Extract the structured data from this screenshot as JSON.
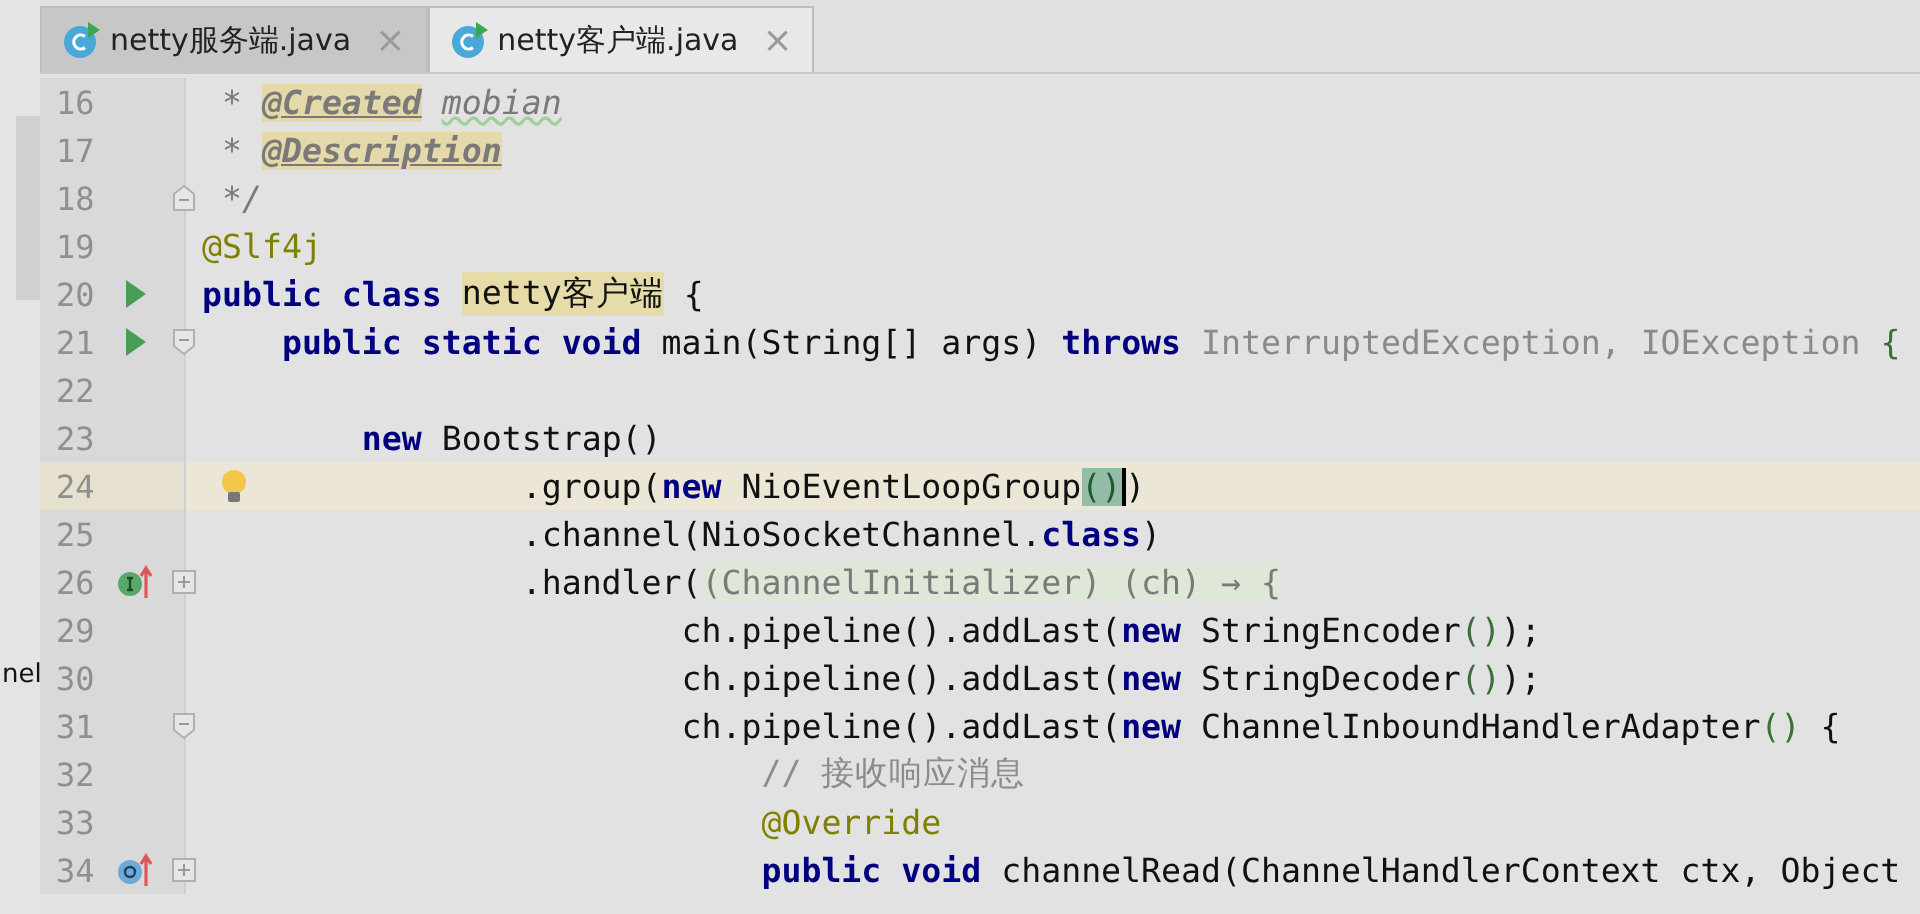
{
  "side_panel": {
    "text": "nel"
  },
  "tabs": [
    {
      "label": "netty服务端.java",
      "selected": false,
      "close": "×"
    },
    {
      "label": "netty客户端.java",
      "selected": true,
      "close": "×"
    }
  ],
  "lines": [
    {
      "number": "16",
      "current": false,
      "tokens": [
        {
          "t": " * ",
          "kind": "doc"
        },
        {
          "t": "@Created",
          "kind": "doc-tag"
        },
        {
          "t": " mobian",
          "kind": "doc-typo"
        }
      ]
    },
    {
      "number": "17",
      "current": false,
      "tokens": [
        {
          "t": " * ",
          "kind": "doc"
        },
        {
          "t": "@Description",
          "kind": "doc-tag"
        }
      ]
    },
    {
      "number": "18",
      "current": false,
      "fold_icon": {
        "kind": "end"
      },
      "tokens": [
        {
          "t": " */",
          "kind": "doc"
        }
      ]
    },
    {
      "number": "19",
      "current": false,
      "tokens": [
        {
          "t": "@Slf4j",
          "kind": "annotation"
        }
      ]
    },
    {
      "number": "20",
      "current": false,
      "gutter_icon": {
        "kind": "run"
      },
      "tokens": [
        {
          "t": "public class ",
          "kind": "keyword"
        },
        {
          "t": "netty客户端",
          "kind": "highlight"
        },
        {
          "t": " {",
          "kind": "plain"
        }
      ]
    },
    {
      "number": "21",
      "current": false,
      "gutter_icon": {
        "kind": "run"
      },
      "fold_icon": {
        "kind": "start"
      },
      "tokens": [
        {
          "t": "    public static void ",
          "kind": "keyword"
        },
        {
          "t": "main(String[] args) ",
          "kind": "plain"
        },
        {
          "t": "throws ",
          "kind": "keyword"
        },
        {
          "t": "InterruptedException, IOException ",
          "kind": "muted"
        },
        {
          "t": "{",
          "kind": "paren"
        }
      ]
    },
    {
      "number": "22",
      "current": false
    },
    {
      "number": "23",
      "current": false,
      "tokens": [
        {
          "t": "        new ",
          "kind": "keyword"
        },
        {
          "t": "Bootstrap()",
          "kind": "plain"
        }
      ]
    },
    {
      "number": "24",
      "current": true,
      "hint": true,
      "tokens": [
        {
          "t": "                .group(",
          "kind": "plain"
        },
        {
          "t": "new ",
          "kind": "keyword"
        },
        {
          "t": "NioEventLoopGroup",
          "kind": "plain"
        },
        {
          "t": "()",
          "kind": "match"
        },
        {
          "t": ")",
          "kind": "plain"
        }
      ]
    },
    {
      "number": "25",
      "current": false,
      "tokens": [
        {
          "t": "                .channel(NioSocketChannel.",
          "kind": "plain"
        },
        {
          "t": "class",
          "kind": "keyword"
        },
        {
          "t": ")",
          "kind": "plain"
        }
      ]
    },
    {
      "number": "26",
      "current": false,
      "gutter_icon": {
        "kind": "implement"
      },
      "fold_icon": {
        "kind": "collapsed"
      },
      "tokens": [
        {
          "t": "                .handler(",
          "kind": "plain"
        },
        {
          "t": "(ChannelInitializer) (ch) → {",
          "kind": "folded"
        }
      ]
    },
    {
      "number": "29",
      "current": false,
      "tokens": [
        {
          "t": "                        ch.pipeline().addLast(",
          "kind": "plain"
        },
        {
          "t": "new ",
          "kind": "keyword"
        },
        {
          "t": "StringEncoder",
          "kind": "plain"
        },
        {
          "t": "()",
          "kind": "paren"
        },
        {
          "t": ");",
          "kind": "plain"
        }
      ]
    },
    {
      "number": "30",
      "current": false,
      "tokens": [
        {
          "t": "                        ch.pipeline().addLast(",
          "kind": "plain"
        },
        {
          "t": "new ",
          "kind": "keyword"
        },
        {
          "t": "StringDecoder",
          "kind": "plain"
        },
        {
          "t": "()",
          "kind": "paren"
        },
        {
          "t": ");",
          "kind": "plain"
        }
      ]
    },
    {
      "number": "31",
      "current": false,
      "fold_icon": {
        "kind": "start"
      },
      "tokens": [
        {
          "t": "                        ch.pipeline().addLast(",
          "kind": "plain"
        },
        {
          "t": "new ",
          "kind": "keyword"
        },
        {
          "t": "ChannelInboundHandlerAdapter",
          "kind": "plain"
        },
        {
          "t": "() ",
          "kind": "paren"
        },
        {
          "t": "{",
          "kind": "plain"
        }
      ]
    },
    {
      "number": "32",
      "current": false,
      "tokens": [
        {
          "t": "                            // 接收响应消息",
          "kind": "comment"
        }
      ]
    },
    {
      "number": "33",
      "current": false,
      "tokens": [
        {
          "t": "                            @Override",
          "kind": "annotation"
        }
      ]
    },
    {
      "number": "34",
      "current": false,
      "gutter_icon": {
        "kind": "override"
      },
      "fold_icon": {
        "kind": "collapsed"
      },
      "tokens": [
        {
          "t": "                            public void ",
          "kind": "keyword"
        },
        {
          "t": "channelRead(ChannelHandlerContext ctx, Object",
          "kind": "plain"
        }
      ]
    }
  ]
}
